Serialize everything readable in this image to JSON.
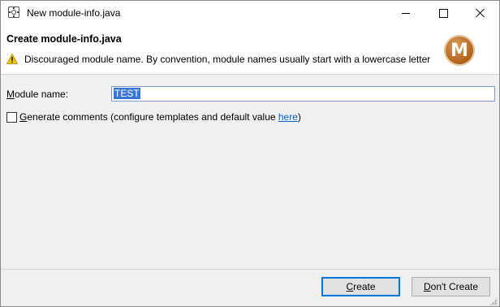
{
  "window": {
    "title": "New module-info.java"
  },
  "header": {
    "title": "Create module-info.java",
    "message": "Discouraged module name. By convention, module names usually start with a lowercase letter",
    "logo_letter": "M"
  },
  "form": {
    "module_name_label_mnemonic": "M",
    "module_name_label_rest": "odule name:",
    "module_name_value": "TEST",
    "generate_comments_mnemonic": "G",
    "generate_comments_rest": "enerate comments",
    "configure_text_prefix": "(configure templates and default value ",
    "configure_link": "here",
    "configure_text_suffix": ")",
    "generate_comments_checked": false
  },
  "footer": {
    "create_mnemonic": "C",
    "create_rest": "reate",
    "dont_create_mnemonic": "D",
    "dont_create_rest": "on't Create"
  },
  "colors": {
    "selection": "#3875d7",
    "link": "#0066cc",
    "warning": "#f5c400",
    "default_button_border": "#0078d7"
  }
}
